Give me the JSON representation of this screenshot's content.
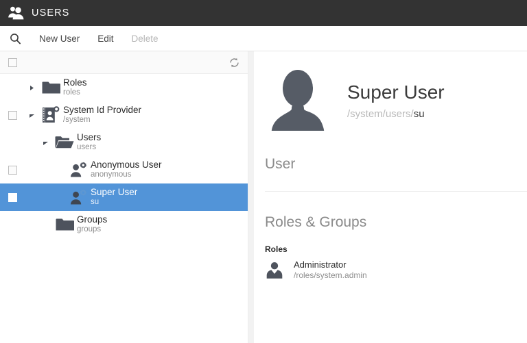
{
  "window": {
    "title": "USERS",
    "title_icon": "users-group-icon",
    "titlebar_color": "#333333"
  },
  "toolbar": {
    "search_icon": "search-icon",
    "items": [
      {
        "label": "New User",
        "name": "new-user-button",
        "disabled": false
      },
      {
        "label": "Edit",
        "name": "edit-button",
        "disabled": false
      },
      {
        "label": "Delete",
        "name": "delete-button",
        "disabled": true
      }
    ]
  },
  "tree_header": {
    "select_all_checked": false,
    "refresh_icon": "refresh-icon"
  },
  "tree": {
    "selection_color": "#5294d8",
    "rows": [
      {
        "name": "Roles",
        "subtitle": "roles",
        "icon": "folder-closed-icon",
        "twisty": "collapsed",
        "checkbox": "none",
        "indent": 36,
        "selected": false
      },
      {
        "name": "System Id Provider",
        "subtitle": "/system",
        "icon": "id-provider-icon",
        "twisty": "expanded",
        "checkbox": "unchecked",
        "indent": 36,
        "selected": false
      },
      {
        "name": "Users",
        "subtitle": "users",
        "icon": "folder-open-icon",
        "twisty": "expanded",
        "checkbox": "none",
        "indent": 56,
        "selected": false
      },
      {
        "name": "Anonymous User",
        "subtitle": "anonymous",
        "icon": "user-gear-icon",
        "twisty": "none",
        "checkbox": "unchecked",
        "indent": 76,
        "selected": false
      },
      {
        "name": "Super User",
        "subtitle": "su",
        "icon": "user-gear-icon",
        "twisty": "none",
        "checkbox": "checked",
        "indent": 76,
        "selected": true
      },
      {
        "name": "Groups",
        "subtitle": "groups",
        "icon": "folder-closed-icon",
        "twisty": "none",
        "checkbox": "none",
        "indent": 56,
        "selected": false
      }
    ]
  },
  "detail": {
    "avatar_icon": "user-avatar-icon",
    "user_name": "Super User",
    "path_prefix": "/system/users/",
    "path_id": "su",
    "sections": [
      {
        "title": "User"
      },
      {
        "title": "Roles & Groups"
      }
    ],
    "roles_label": "Roles",
    "roles": [
      {
        "name": "Administrator",
        "path": "/roles/system.admin",
        "icon": "administrator-icon"
      }
    ]
  }
}
